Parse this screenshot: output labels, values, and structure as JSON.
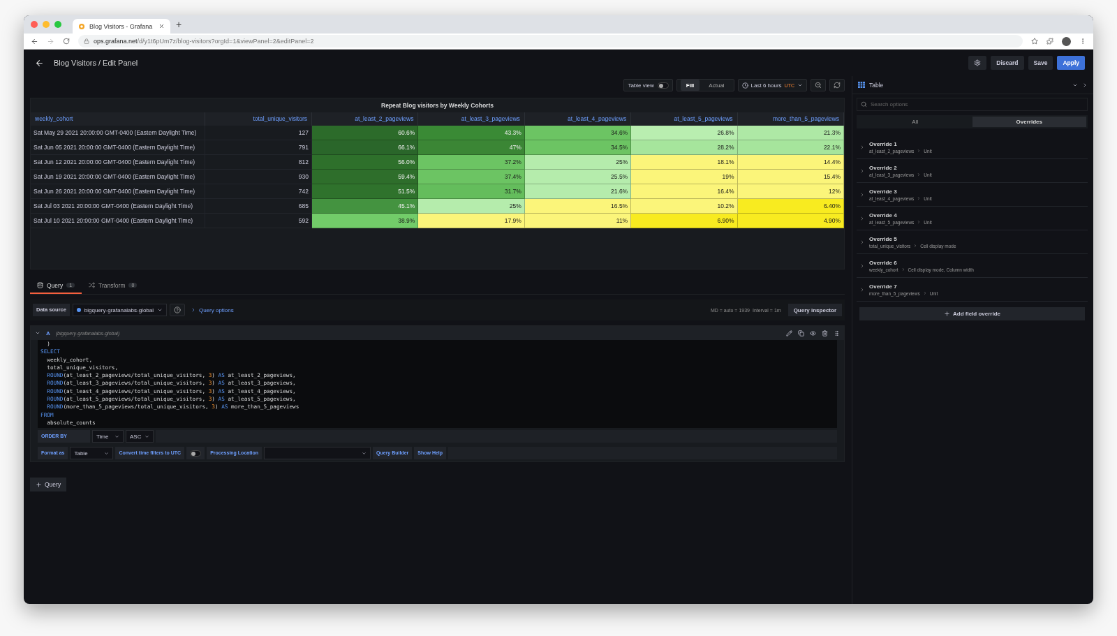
{
  "browser": {
    "tab_title": "Blog Visitors - Grafana",
    "new_tab": "+",
    "url_host": "ops.grafana.net",
    "url_path": "/d/y1t6pUm7z/blog-visitors?orgId=1&viewPanel=2&editPanel=2"
  },
  "header": {
    "title": "Blog Visitors / Edit Panel",
    "buttons": [
      {
        "label": "Discard",
        "kind": "secondary"
      },
      {
        "label": "Save",
        "kind": "secondary"
      },
      {
        "label": "Apply",
        "kind": "primary"
      }
    ]
  },
  "toolbar": {
    "table_view": {
      "label": "Table view",
      "on": false
    },
    "modes": [
      {
        "label": "Fill",
        "selected": true
      },
      {
        "label": "Actual",
        "selected": false
      }
    ],
    "time_range": "Last 6 hours",
    "timezone": "UTC"
  },
  "visualization": {
    "label": "Table"
  },
  "panel": {
    "title": "Repeat Blog visitors by Weekly Cohorts",
    "columns": [
      "weekly_cohort",
      "total_unique_visitors",
      "at_least_2_pageviews",
      "at_least_3_pageviews",
      "at_least_4_pageviews",
      "at_least_5_pageviews",
      "more_than_5_pageviews"
    ],
    "rows": [
      {
        "cells": [
          {
            "text": "Sat May 29 2021 20:00:00 GMT-0400 (Eastern Daylight Time)"
          },
          {
            "text": "127"
          },
          {
            "text": "60.6%",
            "color": "#2c6b2a"
          },
          {
            "text": "43.3%",
            "color": "#3a8a35"
          },
          {
            "text": "34.6%",
            "color": "#6cc463"
          },
          {
            "text": "26.8%",
            "color": "#b9eeb0"
          },
          {
            "text": "21.3%",
            "color": "#aee8a5"
          }
        ]
      },
      {
        "cells": [
          {
            "text": "Sat Jun 05 2021 20:00:00 GMT-0400 (Eastern Daylight Time)"
          },
          {
            "text": "791"
          },
          {
            "text": "66.1%",
            "color": "#2a662a"
          },
          {
            "text": "47%",
            "color": "#3b8635"
          },
          {
            "text": "34.5%",
            "color": "#6cc463"
          },
          {
            "text": "28.2%",
            "color": "#a6e59c"
          },
          {
            "text": "22.1%",
            "color": "#a6e59c"
          }
        ]
      },
      {
        "cells": [
          {
            "text": "Sat Jun 12 2021 20:00:00 GMT-0400 (Eastern Daylight Time)"
          },
          {
            "text": "812"
          },
          {
            "text": "56.0%",
            "color": "#2e702b"
          },
          {
            "text": "37.2%",
            "color": "#6cc463"
          },
          {
            "text": "25%",
            "color": "#b5ecac"
          },
          {
            "text": "18.1%",
            "color": "#fbf57a"
          },
          {
            "text": "14.4%",
            "color": "#fbf57a"
          }
        ]
      },
      {
        "cells": [
          {
            "text": "Sat Jun 19 2021 20:00:00 GMT-0400 (Eastern Daylight Time)"
          },
          {
            "text": "930"
          },
          {
            "text": "59.4%",
            "color": "#2e6e2b"
          },
          {
            "text": "37.4%",
            "color": "#6cc463"
          },
          {
            "text": "25.5%",
            "color": "#b5ecac"
          },
          {
            "text": "19%",
            "color": "#fbf57a"
          },
          {
            "text": "15.4%",
            "color": "#fbf57a"
          }
        ]
      },
      {
        "cells": [
          {
            "text": "Sat Jun 26 2021 20:00:00 GMT-0400 (Eastern Daylight Time)"
          },
          {
            "text": "742"
          },
          {
            "text": "51.5%",
            "color": "#2f722c"
          },
          {
            "text": "31.7%",
            "color": "#64bd5c"
          },
          {
            "text": "21.6%",
            "color": "#b5ecac"
          },
          {
            "text": "16.4%",
            "color": "#fbf57a"
          },
          {
            "text": "12%",
            "color": "#fbf57a"
          }
        ]
      },
      {
        "cells": [
          {
            "text": "Sat Jul 03 2021 20:00:00 GMT-0400 (Eastern Daylight Time)"
          },
          {
            "text": "685"
          },
          {
            "text": "45.1%",
            "color": "#449340"
          },
          {
            "text": "25%",
            "color": "#b5ecac"
          },
          {
            "text": "16.5%",
            "color": "#fbf57a"
          },
          {
            "text": "10.2%",
            "color": "#fbf57a"
          },
          {
            "text": "6.40%",
            "color": "#f8eb20"
          }
        ]
      },
      {
        "cells": [
          {
            "text": "Sat Jul 10 2021 20:00:00 GMT-0400 (Eastern Daylight Time)"
          },
          {
            "text": "592"
          },
          {
            "text": "38.9%",
            "color": "#72cc69"
          },
          {
            "text": "17.9%",
            "color": "#fbf57a"
          },
          {
            "text": "11%",
            "color": "#fbf57a"
          },
          {
            "text": "6.90%",
            "color": "#f8eb20"
          },
          {
            "text": "4.90%",
            "color": "#f8eb20"
          }
        ]
      }
    ]
  },
  "query_tabs": [
    {
      "label": "Query",
      "count": "1",
      "selected": true
    },
    {
      "label": "Transform",
      "count": "0",
      "selected": false
    }
  ],
  "datasource_row": {
    "label": "Data source",
    "datasource": "bigquery-grafanalabs-global",
    "query_options": "Query options",
    "max_data_points": "MD = auto = 1939",
    "interval": "Interval = 1m",
    "inspector": "Query inspector"
  },
  "query": {
    "ref": "A",
    "source": "(bigquery-grafanalabs-global)",
    "expanded": true,
    "code": [
      [
        {
          "text": "  )",
          "kind": "plain"
        }
      ],
      [
        {
          "text": "SELECT",
          "kind": "keyword"
        }
      ],
      [
        {
          "text": "  weekly_cohort,",
          "kind": "plain"
        }
      ],
      [
        {
          "text": "  total_unique_visitors,",
          "kind": "plain"
        }
      ],
      [
        {
          "text": "  ROUND",
          "kind": "function"
        },
        {
          "text": "(at_least_2_pageviews/total_unique_visitors, ",
          "kind": "plain"
        },
        {
          "text": "3",
          "kind": "number"
        },
        {
          "text": ") ",
          "kind": "plain"
        },
        {
          "text": "AS",
          "kind": "keyword"
        },
        {
          "text": " at_least_2_pageviews,",
          "kind": "plain"
        }
      ],
      [
        {
          "text": "  ROUND",
          "kind": "function"
        },
        {
          "text": "(at_least_3_pageviews/total_unique_visitors, ",
          "kind": "plain"
        },
        {
          "text": "3",
          "kind": "number"
        },
        {
          "text": ") ",
          "kind": "plain"
        },
        {
          "text": "AS",
          "kind": "keyword"
        },
        {
          "text": " at_least_3_pageviews,",
          "kind": "plain"
        }
      ],
      [
        {
          "text": "  ROUND",
          "kind": "function"
        },
        {
          "text": "(at_least_4_pageviews/total_unique_visitors, ",
          "kind": "plain"
        },
        {
          "text": "3",
          "kind": "number"
        },
        {
          "text": ") ",
          "kind": "plain"
        },
        {
          "text": "AS",
          "kind": "keyword"
        },
        {
          "text": " at_least_4_pageviews,",
          "kind": "plain"
        }
      ],
      [
        {
          "text": "  ROUND",
          "kind": "function"
        },
        {
          "text": "(at_least_5_pageviews/total_unique_visitors, ",
          "kind": "plain"
        },
        {
          "text": "3",
          "kind": "number"
        },
        {
          "text": ") ",
          "kind": "plain"
        },
        {
          "text": "AS",
          "kind": "keyword"
        },
        {
          "text": " at_least_5_pageviews,",
          "kind": "plain"
        }
      ],
      [
        {
          "text": "  ROUND",
          "kind": "function"
        },
        {
          "text": "(more_than_5_pageviews/total_unique_visitors, ",
          "kind": "plain"
        },
        {
          "text": "3",
          "kind": "number"
        },
        {
          "text": ") ",
          "kind": "plain"
        },
        {
          "text": "AS",
          "kind": "keyword"
        },
        {
          "text": " more_than_5_pageviews",
          "kind": "plain"
        }
      ],
      [
        {
          "text": "FROM",
          "kind": "keyword"
        }
      ],
      [
        {
          "text": "  absolute_counts",
          "kind": "plain"
        }
      ]
    ],
    "order_by": {
      "label": "ORDER BY",
      "selects": [
        "Time",
        "ASC"
      ]
    },
    "format": {
      "label": "Format as",
      "value": "Table",
      "utc_label": "Convert time filters to UTC",
      "utc_on": false,
      "location_label": "Processing Location",
      "builder": "Query Builder",
      "help": "Show Help"
    }
  },
  "add_query": "Query",
  "options": {
    "search_placeholder": "Search options",
    "tabs": [
      {
        "label": "All",
        "selected": false
      },
      {
        "label": "Overrides",
        "selected": true
      }
    ],
    "overrides": [
      {
        "name": "Override 1",
        "field": "at_least_2_pageviews",
        "properties": "Unit"
      },
      {
        "name": "Override 2",
        "field": "at_least_3_pageviews",
        "properties": "Unit"
      },
      {
        "name": "Override 3",
        "field": "at_least_4_pageviews",
        "properties": "Unit"
      },
      {
        "name": "Override 4",
        "field": "at_least_5_pageviews",
        "properties": "Unit"
      },
      {
        "name": "Override 5",
        "field": "total_unique_visitors",
        "properties": "Cell display mode"
      },
      {
        "name": "Override 6",
        "field": "weekly_cohort",
        "properties": "Cell display mode, Column width"
      },
      {
        "name": "Override 7",
        "field": "more_than_5_pageviews",
        "properties": "Unit"
      }
    ],
    "add_override": "Add field override"
  }
}
